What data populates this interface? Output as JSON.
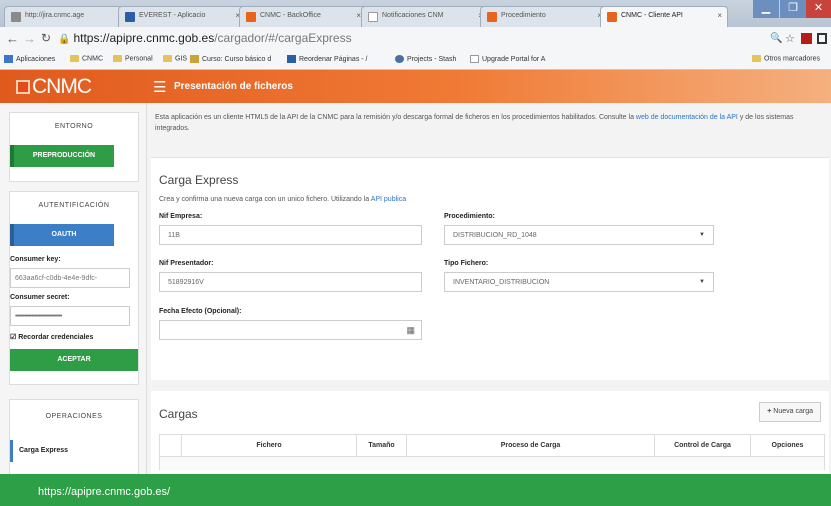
{
  "browser": {
    "tabs": [
      {
        "label": "http://jira.cnmc.age",
        "color": "#8a8a8a"
      },
      {
        "label": "EVEREST - Aplicacio",
        "color": "#2a5fa8"
      },
      {
        "label": "CNMC - BackOffice",
        "color": "#e8641e"
      },
      {
        "label": "Notificaciones CNM",
        "color": "#9aa3ad"
      },
      {
        "label": "Procedimiento",
        "color": "#e8641e"
      },
      {
        "label": "CNMC - Cliente API",
        "color": "#e8641e"
      }
    ],
    "url_host": "https://apipre.cnmc.gob.es",
    "url_path": "/cargador/#/cargaExpress",
    "bookmarks": [
      "Aplicaciones",
      "CNMC",
      "Personal",
      "GIS",
      "Curso: Curso básico d",
      "Reordenar Páginas - /",
      "Projects - Stash",
      "Upgrade Portal for A"
    ],
    "other_bookmarks": "Otros marcadores"
  },
  "header": {
    "logo": "CNMC",
    "title": "Presentación de ficheros"
  },
  "sidebar": {
    "entorno_title": "ENTORNO",
    "entorno_button": "PREPRODUCCIÓN",
    "auth_title": "AUTENTIFICACIÓN",
    "auth_button": "OAUTH",
    "consumer_key_label": "Consumer key:",
    "consumer_key_value": "663aa6cf-c0db-4e4e-9dfc-",
    "consumer_secret_label": "Consumer secret:",
    "consumer_secret_value": "••••••••••••••••••••••••••••••••",
    "remember_label": "Recordar credenciales",
    "accept_button": "ACEPTAR",
    "ops_title": "OPERACIONES",
    "ops_item": "Carga Express"
  },
  "main": {
    "intro_1": "Esta aplicación es un cliente HTML5 de la API de la CNMC para la remisión y/o descarga formal de ficheros en los procedimientos habilitados. Consulte la ",
    "intro_link": "web de documentación de la API",
    "intro_2": " y de los sistemas integrados.",
    "carga_title": "Carga Express",
    "carga_desc": "Crea y confirma una nueva carga con un unico fichero. Utilizando la ",
    "carga_link": "API publica",
    "nif_empresa_label": "Nif Empresa:",
    "nif_empresa_value": "11B",
    "procedimiento_label": "Procedimiento:",
    "procedimiento_value": "DISTRIBUCION_RD_1048",
    "nif_presentador_label": "Nif Presentador:",
    "nif_presentador_value": "51892916V",
    "tipo_fichero_label": "Tipo Fichero:",
    "tipo_fichero_value": "INVENTARIO_DISTRIBUCION",
    "fecha_label": "Fecha Efecto (Opcional):",
    "cargas_title": "Cargas",
    "new_button": "Nueva carga",
    "columns": [
      "Fichero",
      "Tamaño",
      "Proceso de Carga",
      "Control de Carga",
      "Opciones"
    ]
  },
  "status_url": "https://apipre.cnmc.gob.es/"
}
